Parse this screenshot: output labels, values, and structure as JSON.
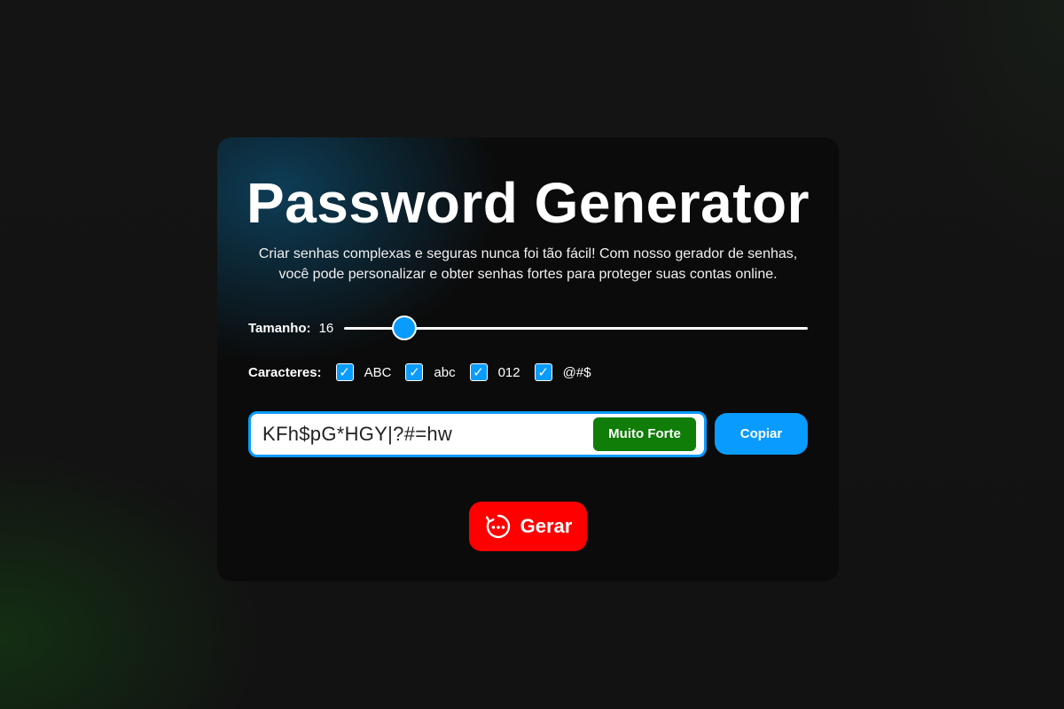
{
  "app": {
    "title": "Password Generator",
    "description": "Criar senhas complexas e seguras nunca foi tão fácil! Com nosso gerador de senhas, você pode personalizar e obter senhas fortes para proteger suas contas online."
  },
  "size": {
    "label": "Tamanho:",
    "value": "16",
    "slider_fraction": 0.11
  },
  "characters": {
    "label": "Caracteres:",
    "options": [
      {
        "label": "ABC",
        "checked": true
      },
      {
        "label": "abc",
        "checked": true
      },
      {
        "label": "012",
        "checked": true
      },
      {
        "label": "@#$",
        "checked": true
      }
    ]
  },
  "password": {
    "value": "KFh$pG*HGY|?#=hw",
    "strength": "Muito Forte"
  },
  "actions": {
    "copy_label": "Copiar",
    "generate_label": "Gerar"
  },
  "colors": {
    "accent": "#0a9bff",
    "strength_very_strong": "#0f7d07",
    "generate": "#ff0000"
  },
  "icons": {
    "check": "checkmark-icon",
    "generate": "refresh-password-icon"
  }
}
